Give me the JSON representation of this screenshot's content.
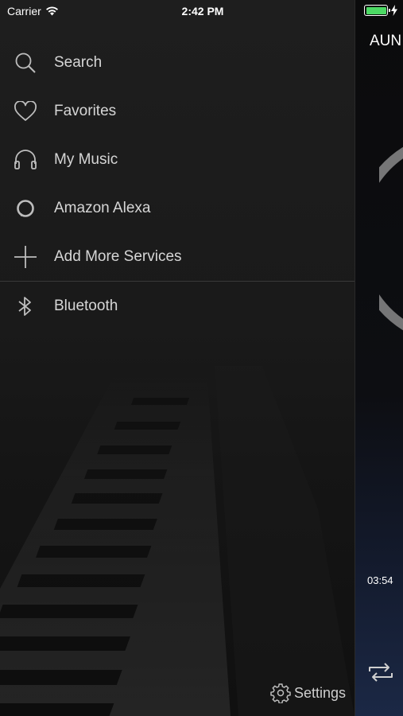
{
  "status_bar": {
    "carrier": "Carrier",
    "time": "2:42 PM"
  },
  "menu": {
    "items": [
      {
        "label": "Search",
        "icon": "search-icon"
      },
      {
        "label": "Favorites",
        "icon": "heart-icon"
      },
      {
        "label": "My Music",
        "icon": "headphones-icon"
      },
      {
        "label": "Amazon Alexa",
        "icon": "alexa-icon"
      },
      {
        "label": "Add More Services",
        "icon": "plus-icon"
      },
      {
        "label": "Bluetooth",
        "icon": "bluetooth-icon"
      }
    ],
    "settings_label": "Settings"
  },
  "player": {
    "title": "AUN",
    "time": "03:54",
    "repeat_icon": "repeat-icon"
  },
  "colors": {
    "battery": "#4cd964",
    "drawer_bg": "#1a1a1a",
    "label": "#d6d6d6"
  }
}
